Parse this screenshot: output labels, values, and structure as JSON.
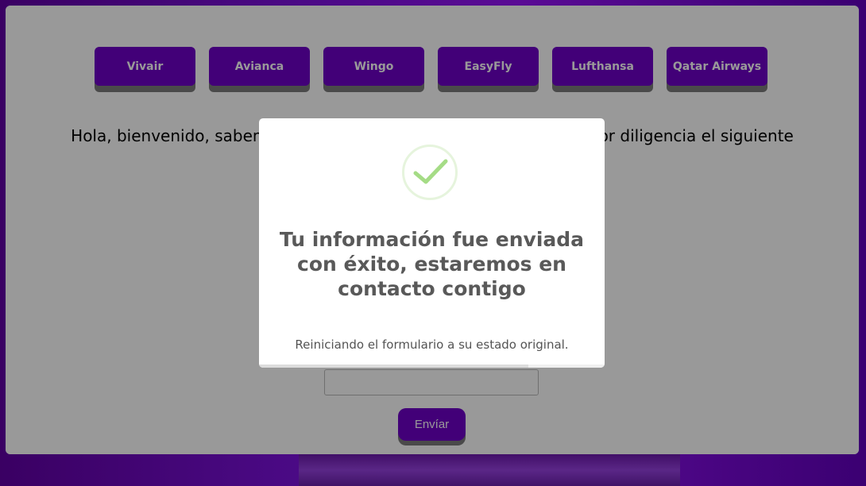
{
  "nav": {
    "airlines": [
      {
        "label": "Vivair"
      },
      {
        "label": "Avianca"
      },
      {
        "label": "Wingo"
      },
      {
        "label": "EasyFly"
      },
      {
        "label": "Lufthansa"
      },
      {
        "label": "Qatar Airways"
      }
    ]
  },
  "main": {
    "welcome_text": "Hola, bienvenido, sabemos que quieres viajar en un vuelo, por favor diligencia el siguiente",
    "input_value": "",
    "submit_label": "Envíar"
  },
  "modal": {
    "icon": "check-icon",
    "title": "Tu información fue enviada con éxito, estaremos en contacto contigo",
    "text": "Reiniciando el formulario a su estado original.",
    "progress": 0.78
  },
  "colors": {
    "accent": "#6f00c9",
    "success": "#a5dc86",
    "overlay": "rgba(0,0,0,0.4)"
  }
}
